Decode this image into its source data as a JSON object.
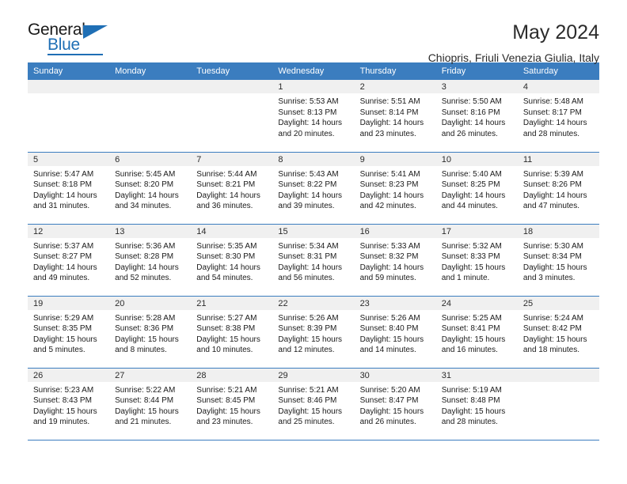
{
  "logo": {
    "word1": "General",
    "word2": "Blue",
    "icon": "triangle-logo-mark",
    "accent_color": "#1f6fb5"
  },
  "header": {
    "title": "May 2024",
    "subtitle": "Chiopris, Friuli Venezia Giulia, Italy"
  },
  "calendar": {
    "header_bg": "#3b7dbf",
    "daynum_bg": "#f0f0f0",
    "weekday_headers": [
      "Sunday",
      "Monday",
      "Tuesday",
      "Wednesday",
      "Thursday",
      "Friday",
      "Saturday"
    ],
    "weeks": [
      [
        {
          "day": "",
          "sunrise": "",
          "sunset": "",
          "daylight_line1": "",
          "daylight_line2": ""
        },
        {
          "day": "",
          "sunrise": "",
          "sunset": "",
          "daylight_line1": "",
          "daylight_line2": ""
        },
        {
          "day": "",
          "sunrise": "",
          "sunset": "",
          "daylight_line1": "",
          "daylight_line2": ""
        },
        {
          "day": "1",
          "sunrise": "Sunrise: 5:53 AM",
          "sunset": "Sunset: 8:13 PM",
          "daylight_line1": "Daylight: 14 hours",
          "daylight_line2": "and 20 minutes."
        },
        {
          "day": "2",
          "sunrise": "Sunrise: 5:51 AM",
          "sunset": "Sunset: 8:14 PM",
          "daylight_line1": "Daylight: 14 hours",
          "daylight_line2": "and 23 minutes."
        },
        {
          "day": "3",
          "sunrise": "Sunrise: 5:50 AM",
          "sunset": "Sunset: 8:16 PM",
          "daylight_line1": "Daylight: 14 hours",
          "daylight_line2": "and 26 minutes."
        },
        {
          "day": "4",
          "sunrise": "Sunrise: 5:48 AM",
          "sunset": "Sunset: 8:17 PM",
          "daylight_line1": "Daylight: 14 hours",
          "daylight_line2": "and 28 minutes."
        }
      ],
      [
        {
          "day": "5",
          "sunrise": "Sunrise: 5:47 AM",
          "sunset": "Sunset: 8:18 PM",
          "daylight_line1": "Daylight: 14 hours",
          "daylight_line2": "and 31 minutes."
        },
        {
          "day": "6",
          "sunrise": "Sunrise: 5:45 AM",
          "sunset": "Sunset: 8:20 PM",
          "daylight_line1": "Daylight: 14 hours",
          "daylight_line2": "and 34 minutes."
        },
        {
          "day": "7",
          "sunrise": "Sunrise: 5:44 AM",
          "sunset": "Sunset: 8:21 PM",
          "daylight_line1": "Daylight: 14 hours",
          "daylight_line2": "and 36 minutes."
        },
        {
          "day": "8",
          "sunrise": "Sunrise: 5:43 AM",
          "sunset": "Sunset: 8:22 PM",
          "daylight_line1": "Daylight: 14 hours",
          "daylight_line2": "and 39 minutes."
        },
        {
          "day": "9",
          "sunrise": "Sunrise: 5:41 AM",
          "sunset": "Sunset: 8:23 PM",
          "daylight_line1": "Daylight: 14 hours",
          "daylight_line2": "and 42 minutes."
        },
        {
          "day": "10",
          "sunrise": "Sunrise: 5:40 AM",
          "sunset": "Sunset: 8:25 PM",
          "daylight_line1": "Daylight: 14 hours",
          "daylight_line2": "and 44 minutes."
        },
        {
          "day": "11",
          "sunrise": "Sunrise: 5:39 AM",
          "sunset": "Sunset: 8:26 PM",
          "daylight_line1": "Daylight: 14 hours",
          "daylight_line2": "and 47 minutes."
        }
      ],
      [
        {
          "day": "12",
          "sunrise": "Sunrise: 5:37 AM",
          "sunset": "Sunset: 8:27 PM",
          "daylight_line1": "Daylight: 14 hours",
          "daylight_line2": "and 49 minutes."
        },
        {
          "day": "13",
          "sunrise": "Sunrise: 5:36 AM",
          "sunset": "Sunset: 8:28 PM",
          "daylight_line1": "Daylight: 14 hours",
          "daylight_line2": "and 52 minutes."
        },
        {
          "day": "14",
          "sunrise": "Sunrise: 5:35 AM",
          "sunset": "Sunset: 8:30 PM",
          "daylight_line1": "Daylight: 14 hours",
          "daylight_line2": "and 54 minutes."
        },
        {
          "day": "15",
          "sunrise": "Sunrise: 5:34 AM",
          "sunset": "Sunset: 8:31 PM",
          "daylight_line1": "Daylight: 14 hours",
          "daylight_line2": "and 56 minutes."
        },
        {
          "day": "16",
          "sunrise": "Sunrise: 5:33 AM",
          "sunset": "Sunset: 8:32 PM",
          "daylight_line1": "Daylight: 14 hours",
          "daylight_line2": "and 59 minutes."
        },
        {
          "day": "17",
          "sunrise": "Sunrise: 5:32 AM",
          "sunset": "Sunset: 8:33 PM",
          "daylight_line1": "Daylight: 15 hours",
          "daylight_line2": "and 1 minute."
        },
        {
          "day": "18",
          "sunrise": "Sunrise: 5:30 AM",
          "sunset": "Sunset: 8:34 PM",
          "daylight_line1": "Daylight: 15 hours",
          "daylight_line2": "and 3 minutes."
        }
      ],
      [
        {
          "day": "19",
          "sunrise": "Sunrise: 5:29 AM",
          "sunset": "Sunset: 8:35 PM",
          "daylight_line1": "Daylight: 15 hours",
          "daylight_line2": "and 5 minutes."
        },
        {
          "day": "20",
          "sunrise": "Sunrise: 5:28 AM",
          "sunset": "Sunset: 8:36 PM",
          "daylight_line1": "Daylight: 15 hours",
          "daylight_line2": "and 8 minutes."
        },
        {
          "day": "21",
          "sunrise": "Sunrise: 5:27 AM",
          "sunset": "Sunset: 8:38 PM",
          "daylight_line1": "Daylight: 15 hours",
          "daylight_line2": "and 10 minutes."
        },
        {
          "day": "22",
          "sunrise": "Sunrise: 5:26 AM",
          "sunset": "Sunset: 8:39 PM",
          "daylight_line1": "Daylight: 15 hours",
          "daylight_line2": "and 12 minutes."
        },
        {
          "day": "23",
          "sunrise": "Sunrise: 5:26 AM",
          "sunset": "Sunset: 8:40 PM",
          "daylight_line1": "Daylight: 15 hours",
          "daylight_line2": "and 14 minutes."
        },
        {
          "day": "24",
          "sunrise": "Sunrise: 5:25 AM",
          "sunset": "Sunset: 8:41 PM",
          "daylight_line1": "Daylight: 15 hours",
          "daylight_line2": "and 16 minutes."
        },
        {
          "day": "25",
          "sunrise": "Sunrise: 5:24 AM",
          "sunset": "Sunset: 8:42 PM",
          "daylight_line1": "Daylight: 15 hours",
          "daylight_line2": "and 18 minutes."
        }
      ],
      [
        {
          "day": "26",
          "sunrise": "Sunrise: 5:23 AM",
          "sunset": "Sunset: 8:43 PM",
          "daylight_line1": "Daylight: 15 hours",
          "daylight_line2": "and 19 minutes."
        },
        {
          "day": "27",
          "sunrise": "Sunrise: 5:22 AM",
          "sunset": "Sunset: 8:44 PM",
          "daylight_line1": "Daylight: 15 hours",
          "daylight_line2": "and 21 minutes."
        },
        {
          "day": "28",
          "sunrise": "Sunrise: 5:21 AM",
          "sunset": "Sunset: 8:45 PM",
          "daylight_line1": "Daylight: 15 hours",
          "daylight_line2": "and 23 minutes."
        },
        {
          "day": "29",
          "sunrise": "Sunrise: 5:21 AM",
          "sunset": "Sunset: 8:46 PM",
          "daylight_line1": "Daylight: 15 hours",
          "daylight_line2": "and 25 minutes."
        },
        {
          "day": "30",
          "sunrise": "Sunrise: 5:20 AM",
          "sunset": "Sunset: 8:47 PM",
          "daylight_line1": "Daylight: 15 hours",
          "daylight_line2": "and 26 minutes."
        },
        {
          "day": "31",
          "sunrise": "Sunrise: 5:19 AM",
          "sunset": "Sunset: 8:48 PM",
          "daylight_line1": "Daylight: 15 hours",
          "daylight_line2": "and 28 minutes."
        },
        {
          "day": "",
          "sunrise": "",
          "sunset": "",
          "daylight_line1": "",
          "daylight_line2": ""
        }
      ]
    ]
  }
}
